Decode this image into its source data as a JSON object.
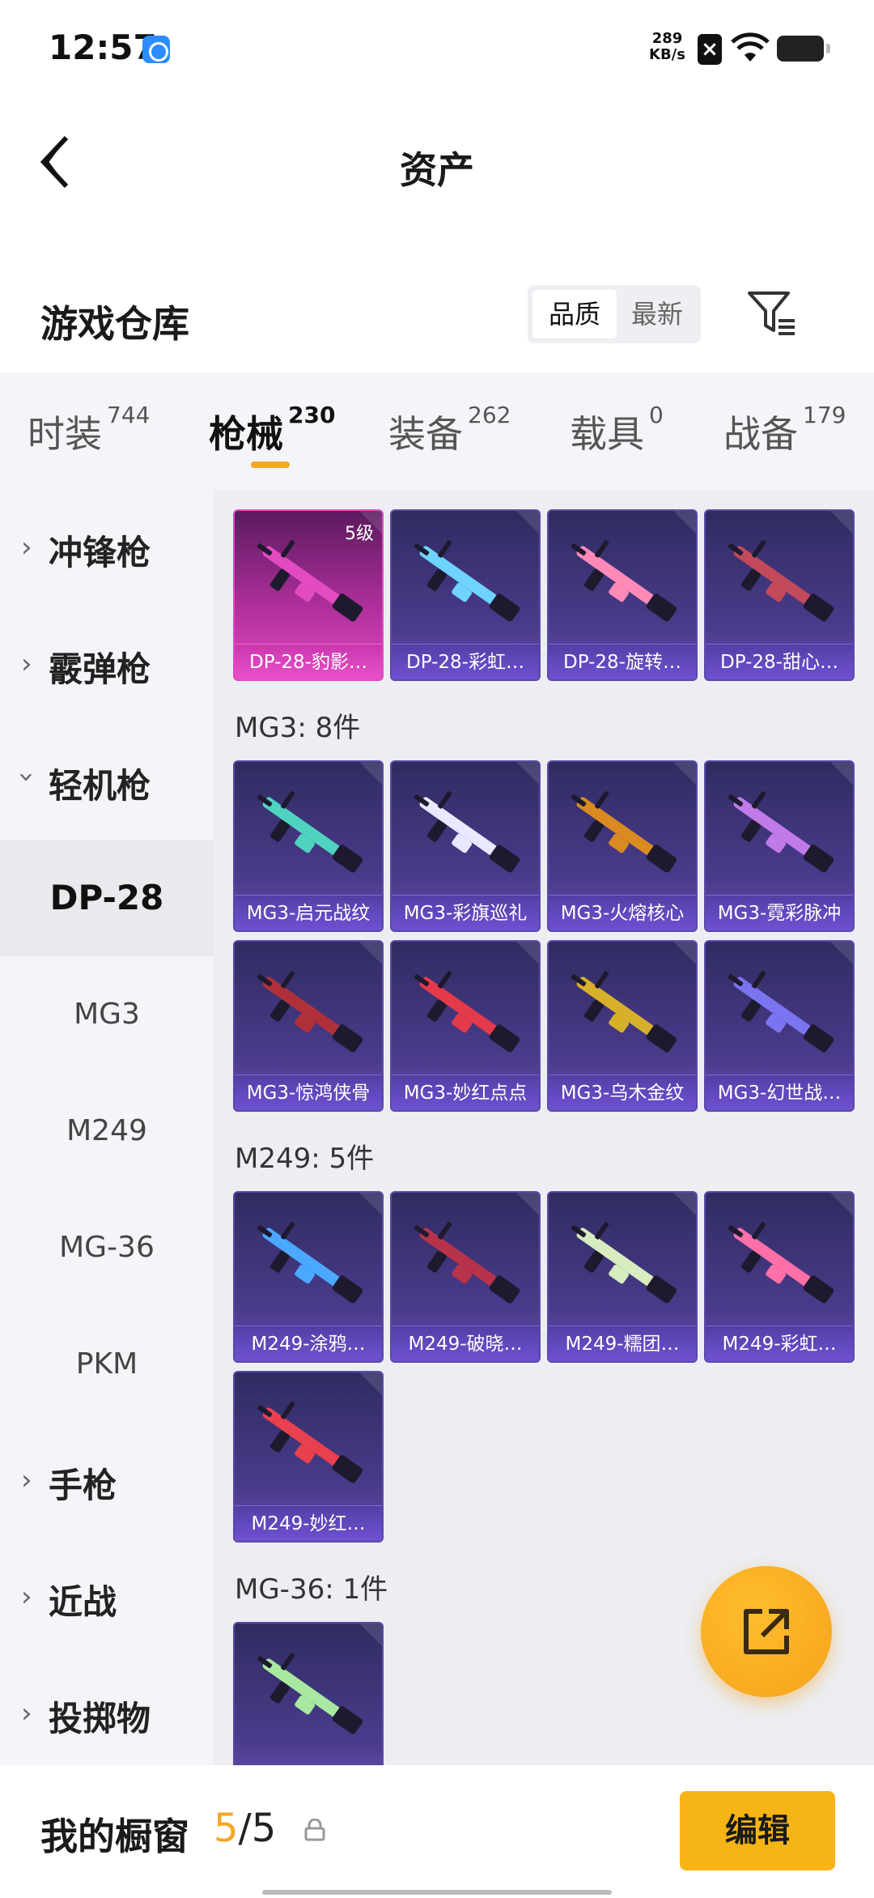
{
  "status_bar": {
    "time": "12:57",
    "speed_value": "289",
    "speed_unit": "KB/s"
  },
  "header": {
    "title": "资产"
  },
  "warehouse": {
    "label": "游戏仓库",
    "sort_quality": "品质",
    "sort_newest": "最新"
  },
  "tabs": [
    {
      "label": "时装",
      "count": "744"
    },
    {
      "label": "枪械",
      "count": "230"
    },
    {
      "label": "装备",
      "count": "262"
    },
    {
      "label": "载具",
      "count": "0"
    },
    {
      "label": "战备",
      "count": "179"
    }
  ],
  "sidebar": {
    "groups": [
      "冲锋枪",
      "霰弹枪",
      "轻机枪",
      "手枪",
      "近战",
      "投掷物"
    ],
    "subs": [
      "DP-28",
      "MG3",
      "M249",
      "MG-36",
      "PKM"
    ]
  },
  "sections": {
    "mg3": "MG3: 8件",
    "m249": "M249: 5件",
    "mg36": "MG-36: 1件"
  },
  "items": {
    "dp28": [
      {
        "name": "DP-28-豹影…",
        "level": "5级",
        "color": "#e24bc2"
      },
      {
        "name": "DP-28-彩虹…",
        "color": "#6fd3ff"
      },
      {
        "name": "DP-28-旋转…",
        "color": "#ff8ab8"
      },
      {
        "name": "DP-28-甜心…",
        "color": "#c24a5a"
      }
    ],
    "mg3": [
      {
        "name": "MG3-启元战纹",
        "color": "#4fd3c0"
      },
      {
        "name": "MG3-彩旗巡礼",
        "color": "#e8e8ff"
      },
      {
        "name": "MG3-火熔核心",
        "color": "#d98a20"
      },
      {
        "name": "MG3-霓彩脉冲",
        "color": "#c07be8"
      },
      {
        "name": "MG3-惊鸿侠骨",
        "color": "#b0303a"
      },
      {
        "name": "MG3-妙红点点",
        "color": "#e53a4a"
      },
      {
        "name": "MG3-乌木金纹",
        "color": "#d6b02a"
      },
      {
        "name": "MG3-幻世战…",
        "color": "#7a74f0"
      }
    ],
    "m249": [
      {
        "name": "M249-涂鸦…",
        "color": "#4aa8ff"
      },
      {
        "name": "M249-破晓…",
        "color": "#b8334a"
      },
      {
        "name": "M249-糯团…",
        "color": "#d8ecc0"
      },
      {
        "name": "M249-彩虹…",
        "color": "#ff6fa8"
      },
      {
        "name": "M249-妙红…",
        "color": "#e8404c"
      }
    ],
    "mg36": [
      {
        "name": "",
        "color": "#a8e8a0"
      }
    ]
  },
  "bottom": {
    "label": "我的橱窗",
    "current": "5",
    "total": "/5",
    "edit": "编辑"
  }
}
